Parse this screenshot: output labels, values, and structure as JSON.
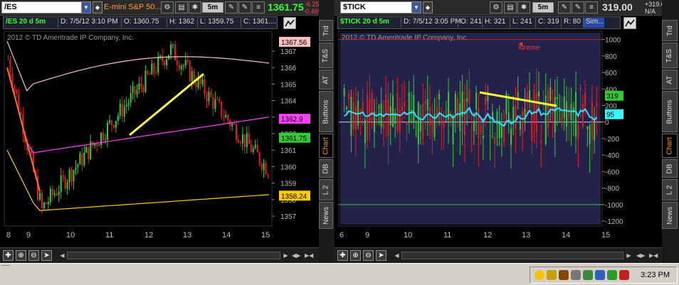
{
  "left": {
    "symbol": "/ES",
    "description": "E-mini S&P 50...",
    "period": "5m",
    "last": "1361.75",
    "change": "-6.25",
    "change_pct": "-0.46%",
    "info": {
      "study": "/ES 20 d 5m",
      "date": "D: 7/5/12 3:10 PM",
      "open": "O: 1360.75",
      "high": "H: 1362",
      "low": "L: 1359.75",
      "close": "C: 1361...."
    },
    "watermark": "2012 © TD Ameritrade IP Company, Inc.",
    "yticks": [
      "1367",
      "1366",
      "1365",
      "1364",
      "1363",
      "1362",
      "1361",
      "1360",
      "1359",
      "1358",
      "1357"
    ],
    "xticks": [
      "8",
      "9",
      "10",
      "11",
      "12",
      "13",
      "14",
      "15"
    ],
    "price_tags": [
      {
        "text": "1367.56",
        "bg": "#ffc0c0",
        "fg": "#000000",
        "y": 1367.56
      },
      {
        "text": "1362.9",
        "bg": "#ff40ff",
        "fg": "#000000",
        "y": 1362.9
      },
      {
        "text": "1361.75",
        "bg": "#33cc33",
        "fg": "#000000",
        "y": 1361.75
      },
      {
        "text": "1358.24",
        "bg": "#ffcc00",
        "fg": "#000000",
        "y": 1358.24
      }
    ],
    "tabs": [
      "Trd",
      "T&S",
      "AT",
      "Buttons",
      "Chart",
      "DB",
      "L 2",
      "News"
    ],
    "active_tab": "Chart"
  },
  "right": {
    "symbol": "$TICK",
    "period": "5m",
    "last": "319.00",
    "change": "+319.00",
    "change_pct": "N/A",
    "info": {
      "study": "$TICK 20 d 5m",
      "date": "D: 7/5/12 3:05 PM",
      "open": "O: 241",
      "high": "H: 321",
      "low": "L: 241",
      "close": "C: 319",
      "r": "R: 80",
      "sim": "Sim..."
    },
    "watermark": "2012 © TD Ameritrade IP Company, Inc.",
    "annotation": "xtreme",
    "yticks": [
      "1000",
      "800",
      "600",
      "400",
      "200",
      "0",
      "-200",
      "-400",
      "-600",
      "-800",
      "-1000",
      "-1200"
    ],
    "xticks": [
      "6",
      "9",
      "10",
      "11",
      "12",
      "13",
      "14",
      "15"
    ],
    "price_tags": [
      {
        "text": "319",
        "bg": "#33cc33",
        "fg": "#000000",
        "y": 319
      },
      {
        "text": "95",
        "bg": "#33ffff",
        "fg": "#000000",
        "y": 95
      }
    ],
    "tabs": [
      "Trd",
      "T&S",
      "AT",
      "Buttons",
      "Chart",
      "DB",
      "L 2",
      "News"
    ],
    "active_tab": "Chart"
  },
  "icons": {
    "gear": "gear-icon",
    "print": "printer-icon",
    "draw": "pencil-icon",
    "zoom_in": "zoom-in-icon",
    "zoom_out": "zoom-out-icon",
    "pointer": "pointer-icon",
    "crosshair": "crosshair-icon"
  },
  "taskbar": {
    "time": "3:23 PM"
  }
}
